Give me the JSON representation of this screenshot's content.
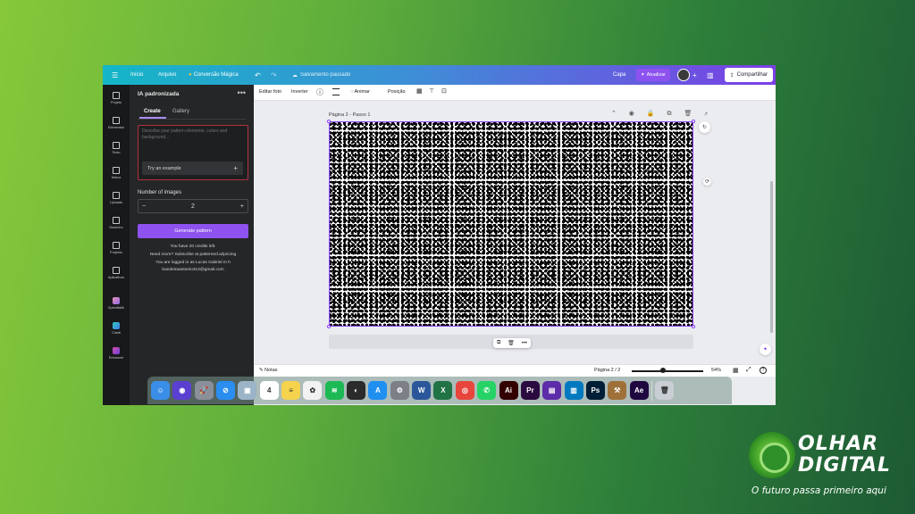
{
  "topbar": {
    "menu": "☰",
    "home": "Início",
    "file": "Arquivo",
    "magic": "Conversão Mágica",
    "undo": "↶",
    "redo": "↷",
    "saved": "Salvamento pausado",
    "doc_title": "Capa",
    "upgrade": "Atualizar",
    "add": "+",
    "stats": "▥",
    "share": "Compartilhar"
  },
  "rail": [
    {
      "label": "Projeto",
      "icon": "layout-icon"
    },
    {
      "label": "Elementos",
      "icon": "elements-icon"
    },
    {
      "label": "Texto",
      "icon": "text-icon"
    },
    {
      "label": "Marca",
      "icon": "brand-icon"
    },
    {
      "label": "Uploads",
      "icon": "upload-icon"
    },
    {
      "label": "Desenho",
      "icon": "draw-icon"
    },
    {
      "label": "Projetos",
      "icon": "folder-icon"
    },
    {
      "label": "Aplicativos",
      "icon": "apps-icon"
    },
    {
      "label": "Speedfaith",
      "icon": "app1-icon"
    },
    {
      "label": "Clariti",
      "icon": "app2-icon"
    },
    {
      "label": "Enhancer",
      "icon": "app3-icon"
    }
  ],
  "panel": {
    "title": "IA padronizada",
    "more": "•••",
    "tabs": [
      "Create",
      "Gallery"
    ],
    "prompt_placeholder": "Describe your pattern elements, colors and background...",
    "try_example": "Try an example",
    "plus": "+",
    "num_images_label": "Number of images",
    "minus": "−",
    "num_images": "2",
    "generate": "Generate pattern",
    "credits": "You have 20 credits left.",
    "need_more": "Need more? Subscribe at patterned.ai/pricing",
    "logged_in": "You are logged in as Lucas Gabriel m h",
    "email": "bandeiraantonio313@gmail.com"
  },
  "toolbar": {
    "edit_photo": "Editar foto",
    "flip": "Inverter",
    "info": "ⓘ",
    "animate": "Animar",
    "position": "Posição"
  },
  "canvas": {
    "page_label": "Página 2 - Passo 1",
    "page_tools": "⌃ ◉ 🔒 ⧉ 🗑 ⤴",
    "float_icons": [
      "⧉",
      "🗑",
      "•••"
    ]
  },
  "bottombar": {
    "notes": "Notas",
    "page_counter": "Página 2 / 2",
    "zoom": "54%",
    "zoom_level": 54,
    "grid": "▦",
    "expand": "⤢",
    "help": "?"
  },
  "dock": [
    {
      "name": "finder",
      "glyph": "☺",
      "color": "#3b8ee8"
    },
    {
      "name": "siri",
      "glyph": "◉",
      "color": "#5b3fd1"
    },
    {
      "name": "launchpad",
      "glyph": "🚀",
      "color": "#8a8f99"
    },
    {
      "name": "safari",
      "glyph": "⊘",
      "color": "#2a8df0"
    },
    {
      "name": "preview",
      "glyph": "▣",
      "color": "#9cb4c8"
    },
    {
      "name": "calendar",
      "glyph": "4",
      "color": "#ffffff"
    },
    {
      "name": "notes",
      "glyph": "≡",
      "color": "#f6d34c"
    },
    {
      "name": "photos",
      "glyph": "✿",
      "color": "#f2f2f2"
    },
    {
      "name": "spotify",
      "glyph": "≋",
      "color": "#1db954"
    },
    {
      "name": "davinci",
      "glyph": "◐",
      "color": "#2b2b2b"
    },
    {
      "name": "appstore",
      "glyph": "A",
      "color": "#1f8ff2"
    },
    {
      "name": "settings",
      "glyph": "⚙",
      "color": "#7c7f86"
    },
    {
      "name": "word",
      "glyph": "W",
      "color": "#2b579a"
    },
    {
      "name": "excel",
      "glyph": "X",
      "color": "#217346"
    },
    {
      "name": "chrome",
      "glyph": "◎",
      "color": "#e8453c"
    },
    {
      "name": "whatsapp",
      "glyph": "✆",
      "color": "#25d366"
    },
    {
      "name": "illustrator",
      "glyph": "Ai",
      "color": "#330000"
    },
    {
      "name": "premiere",
      "glyph": "Pr",
      "color": "#2a0a3f"
    },
    {
      "name": "iina",
      "glyph": "▤",
      "color": "#5d2ca8"
    },
    {
      "name": "trello",
      "glyph": "▥",
      "color": "#0079bf"
    },
    {
      "name": "photoshop",
      "glyph": "Ps",
      "color": "#001e36"
    },
    {
      "name": "utility",
      "glyph": "⚒",
      "color": "#a0703a"
    },
    {
      "name": "aftereffects",
      "glyph": "Ae",
      "color": "#1f0740"
    },
    {
      "name": "trash",
      "glyph": "🗑",
      "color": "#c9ced4"
    }
  ],
  "watermark": {
    "title_line1": "OLHAR",
    "title_line2": "DIGITAL",
    "tagline": "O futuro passa primeiro aqui"
  }
}
